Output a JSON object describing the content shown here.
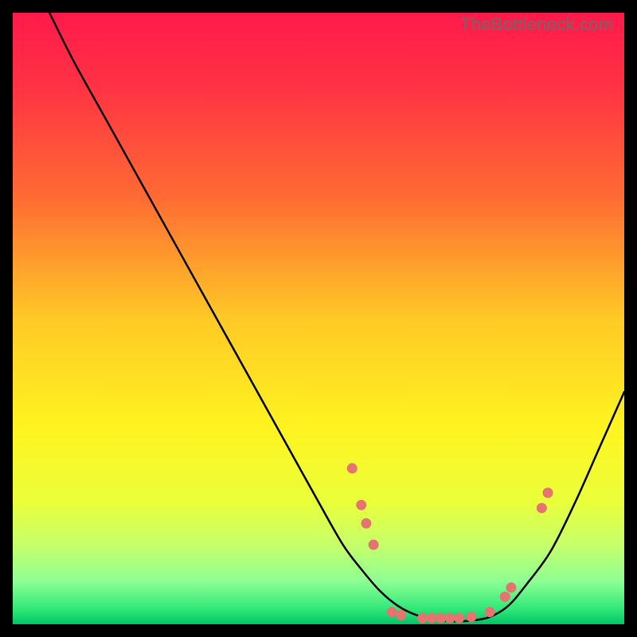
{
  "watermark": "TheBottleneck.com",
  "chart_data": {
    "type": "line",
    "title": "",
    "xlabel": "",
    "ylabel": "",
    "xlim": [
      0,
      100
    ],
    "ylim": [
      0,
      100
    ],
    "gradient_stops": [
      {
        "t": 0.0,
        "color": "#ff1a4b"
      },
      {
        "t": 0.12,
        "color": "#ff3244"
      },
      {
        "t": 0.3,
        "color": "#ff6a33"
      },
      {
        "t": 0.5,
        "color": "#ffc926"
      },
      {
        "t": 0.68,
        "color": "#fff420"
      },
      {
        "t": 0.8,
        "color": "#eaff3a"
      },
      {
        "t": 0.87,
        "color": "#c6ff6a"
      },
      {
        "t": 0.93,
        "color": "#8dff93"
      },
      {
        "t": 0.975,
        "color": "#30e879"
      },
      {
        "t": 1.0,
        "color": "#00c565"
      }
    ],
    "series": [
      {
        "name": "bottleneck-curve",
        "x": [
          6,
          10,
          15,
          20,
          25,
          30,
          35,
          40,
          45,
          50,
          54,
          57,
          60,
          63,
          66,
          69,
          72,
          75,
          78,
          81,
          84,
          88,
          92,
          96,
          100
        ],
        "y": [
          100,
          92,
          83,
          74,
          65,
          56,
          47,
          38,
          29,
          20,
          13,
          9,
          5.5,
          3,
          1.5,
          0.8,
          0.5,
          0.6,
          1.2,
          3,
          6.5,
          12,
          20,
          29,
          38
        ]
      }
    ],
    "markers": [
      {
        "x": 55.5,
        "y": 25.5
      },
      {
        "x": 57.0,
        "y": 19.5
      },
      {
        "x": 57.8,
        "y": 16.5
      },
      {
        "x": 59.0,
        "y": 13.0
      },
      {
        "x": 62.0,
        "y": 2.0
      },
      {
        "x": 63.5,
        "y": 1.5
      },
      {
        "x": 67.0,
        "y": 1.0
      },
      {
        "x": 68.5,
        "y": 1.0
      },
      {
        "x": 70.0,
        "y": 1.0
      },
      {
        "x": 71.5,
        "y": 1.0
      },
      {
        "x": 73.0,
        "y": 1.0
      },
      {
        "x": 75.0,
        "y": 1.2
      },
      {
        "x": 78.0,
        "y": 2.0
      },
      {
        "x": 80.5,
        "y": 4.5
      },
      {
        "x": 81.5,
        "y": 6.0
      },
      {
        "x": 86.5,
        "y": 19.0
      },
      {
        "x": 87.5,
        "y": 21.5
      }
    ],
    "marker_style": {
      "radius": 6.5,
      "fill": "#e5736f"
    },
    "line_style": {
      "stroke": "#000000",
      "width": 2.5
    }
  }
}
